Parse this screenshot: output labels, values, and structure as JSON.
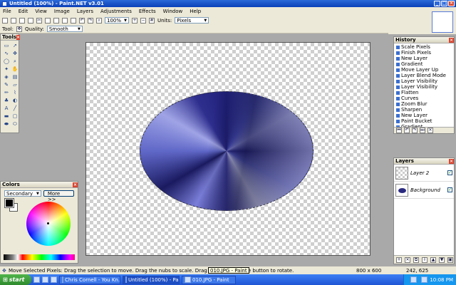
{
  "window": {
    "title": "Untitled (100%) - Paint.NET v3.01"
  },
  "menu": [
    "File",
    "Edit",
    "View",
    "Image",
    "Layers",
    "Adjustments",
    "Effects",
    "Window",
    "Help"
  ],
  "toolbar1": {
    "zoom": "100%",
    "units_label": "Units:",
    "units_value": "Pixels"
  },
  "toolbar2": {
    "tool_label": "Tool:",
    "quality_label": "Quality:",
    "quality_value": "Smooth"
  },
  "tools_panel": {
    "title": "Tools"
  },
  "colors_panel": {
    "title": "Colors",
    "mode": "Secondary",
    "more_button": "More >>"
  },
  "history_panel": {
    "title": "History",
    "items": [
      "Scale Pixels",
      "Finish Pixels",
      "New Layer",
      "Gradient",
      "Move Layer Up",
      "Layer Blend Mode",
      "Layer Visibility",
      "Layer Visibility",
      "Flatten",
      "Curves",
      "Zoom Blur",
      "Sharpen",
      "New Layer",
      "Paint Bucket",
      "Gradient"
    ]
  },
  "layers_panel": {
    "title": "Layers",
    "layers": [
      {
        "name": "Layer 2",
        "visible": true
      },
      {
        "name": "Background",
        "visible": true
      }
    ]
  },
  "status": {
    "message": "Move Selected Pixels: Drag the selection to move. Drag the nubs to scale. Drag with right mouse button to rotate.",
    "image_size": "800 x 600",
    "cursor": "242, 625",
    "tooltip": "010.JPG - Paint"
  },
  "taskbar": {
    "start": "start",
    "tasks": [
      "Chris Cornell - You Kn...",
      "Untitled (100%) - Pai...",
      "010.JPG - Paint"
    ],
    "clock": "10:08 PM"
  },
  "colors": {
    "titlebar": "#0a3fb8",
    "chrome": "#ece9d8",
    "taskbar": "#1f55d4",
    "start": "#2f8a2d"
  }
}
